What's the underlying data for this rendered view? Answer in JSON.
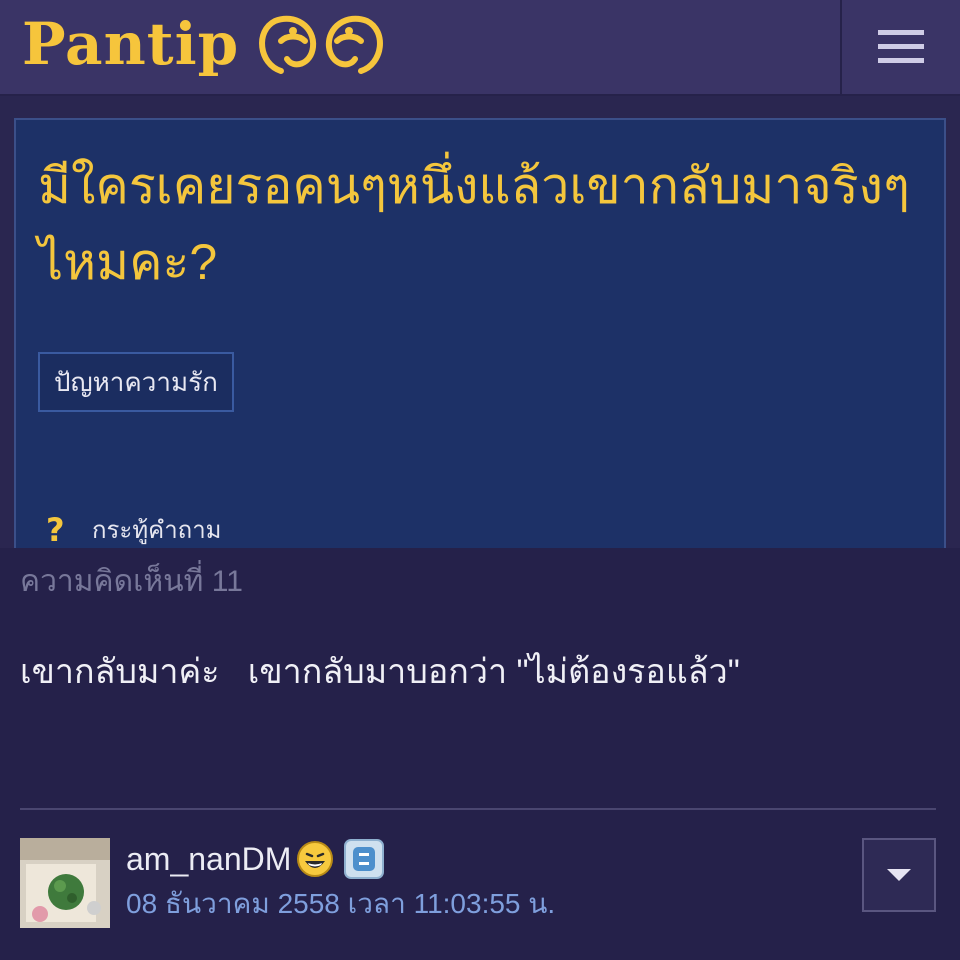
{
  "header": {
    "brand": "Pantip",
    "logo_icon": "pantip-eyes-logo",
    "menu_icon": "hamburger-menu-icon",
    "brand_color": "#f6c53c"
  },
  "topic": {
    "title": "มีใครเคยรอคนๆหนึ่งแล้วเขากลับมาจริงๆไหมคะ?",
    "tag": "ปัญหาความรัก",
    "type_icon": "question-mark-icon",
    "type_label": "กระทู้คำถาม",
    "title_color": "#f4c63d"
  },
  "comment": {
    "number_label": "ความคิดเห็นที่ 11",
    "body": "เขากลับมาค่ะ   เขากลับมาบอกว่า \"ไม่ต้องรอแล้ว\"",
    "author": "am_nanDM",
    "author_emoticon": "laughing-emoticon-icon",
    "member_badge": "blog-badge-icon",
    "timestamp": "08 ธันวาคม 2558 เวลา 11:03:55 น.",
    "options_icon": "caret-down-icon",
    "timestamp_color": "#7f9fdd"
  }
}
